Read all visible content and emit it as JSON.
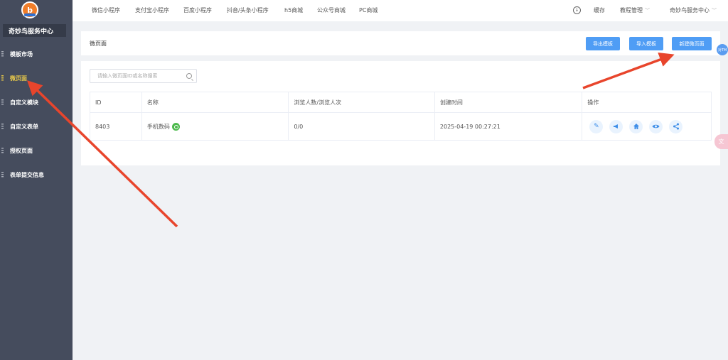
{
  "sidebar": {
    "logo_letter": "b",
    "brand": "奇妙鸟服务中心",
    "items": [
      {
        "label": "模板市场"
      },
      {
        "label": "微页面"
      },
      {
        "label": "自定义模块"
      },
      {
        "label": "自定义表单"
      },
      {
        "label": "授权页面"
      },
      {
        "label": "表单提交信息"
      }
    ],
    "active_index": 1
  },
  "topbar": {
    "links": [
      "微信小程序",
      "支付宝小程序",
      "百度小程序",
      "抖音/头条小程序",
      "h5商城",
      "公众号商城",
      "PC商城"
    ],
    "cache": "缓存",
    "tutorial": "教程管理",
    "account": "奇妙鸟服务中心"
  },
  "header": {
    "title": "微页面",
    "buttons": {
      "export": "导出模板",
      "import": "导入模板",
      "create": "新建微页面"
    }
  },
  "search": {
    "placeholder": "请输入微页面ID或名称搜索"
  },
  "table": {
    "columns": [
      "ID",
      "名称",
      "浏览人数/浏览人次",
      "创建时间",
      "操作"
    ],
    "rows": [
      {
        "id": "8403",
        "name": "手机数码",
        "views": "0/0",
        "created": "2025-04-19 00:27:21"
      }
    ]
  },
  "float_badge": "对TM",
  "side_tab": "文",
  "colors": {
    "accent": "#4f9df5",
    "sidebar": "#454c5d",
    "active": "#e8c94a",
    "arrow": "#e8452c"
  }
}
